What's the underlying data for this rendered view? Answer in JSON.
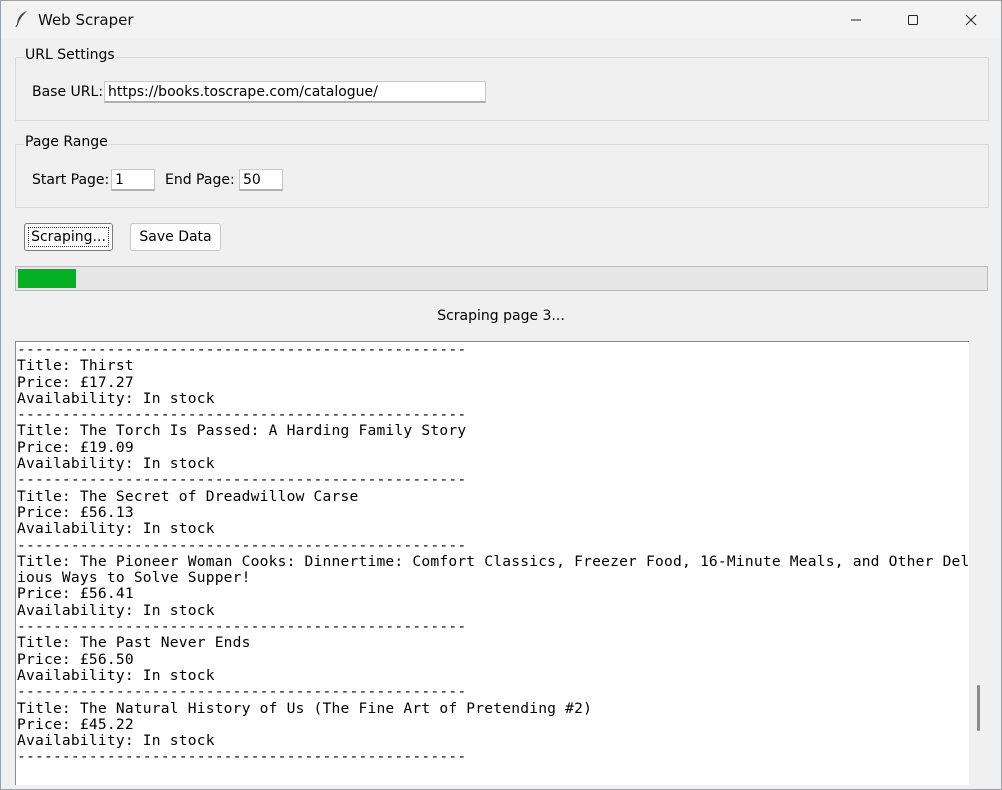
{
  "window": {
    "title": "Web Scraper",
    "icon": "feather-icon"
  },
  "url_settings": {
    "group_label": "URL Settings",
    "base_url_label": "Base URL:",
    "base_url_value": "https://books.toscrape.com/catalogue/"
  },
  "page_range": {
    "group_label": "Page Range",
    "start_label": "Start Page:",
    "start_value": "1",
    "end_label": "End Page:",
    "end_value": "50"
  },
  "actions": {
    "scrape_label": "Scraping...",
    "save_label": "Save Data"
  },
  "progress": {
    "fraction": 0.06,
    "color": "#06b025"
  },
  "status": "Scraping page 3...",
  "log": {
    "lines": [
      "--------------------------------------------------",
      "Title: Thirst",
      "Price: £17.27",
      "Availability: In stock",
      "--------------------------------------------------",
      "Title: The Torch Is Passed: A Harding Family Story",
      "Price: £19.09",
      "Availability: In stock",
      "--------------------------------------------------",
      "Title: The Secret of Dreadwillow Carse",
      "Price: £56.13",
      "Availability: In stock",
      "--------------------------------------------------",
      "Title: The Pioneer Woman Cooks: Dinnertime: Comfort Classics, Freezer Food, 16-Minute Meals, and Other Delic",
      "ious Ways to Solve Supper!",
      "Price: £56.41",
      "Availability: In stock",
      "--------------------------------------------------",
      "Title: The Past Never Ends",
      "Price: £56.50",
      "Availability: In stock",
      "--------------------------------------------------",
      "Title: The Natural History of Us (The Fine Art of Pretending #2)",
      "Price: £45.22",
      "Availability: In stock",
      "--------------------------------------------------"
    ],
    "scroll_position": 0.9
  }
}
